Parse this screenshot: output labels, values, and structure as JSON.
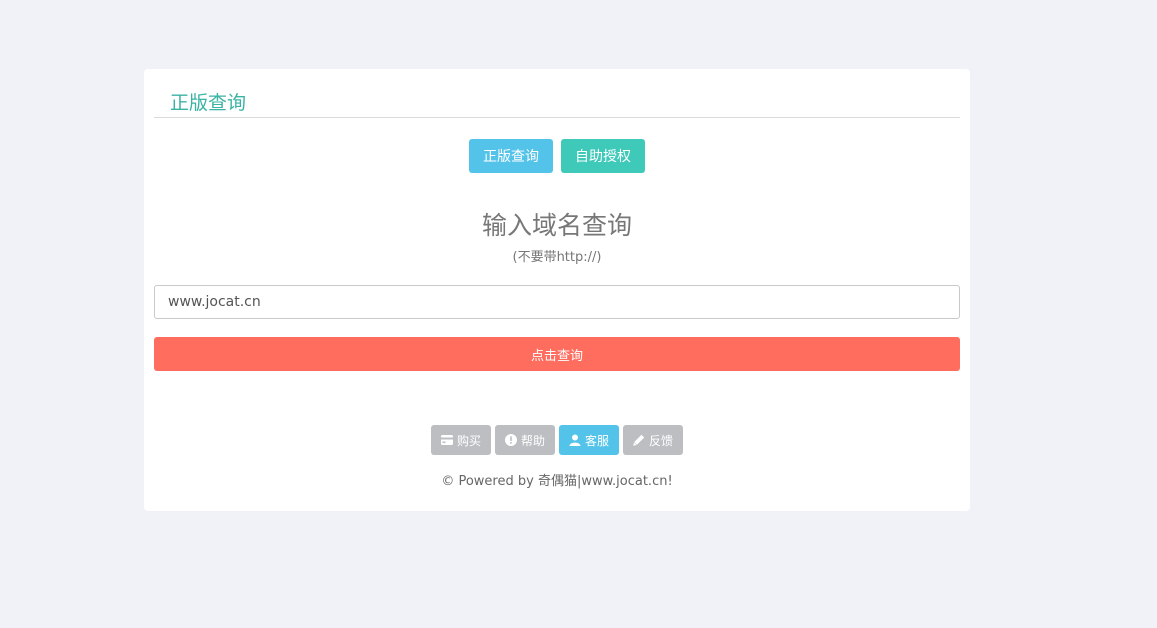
{
  "card": {
    "title": "正版查询"
  },
  "tabs": {
    "query_label": "正版查询",
    "auth_label": "自助授权"
  },
  "query": {
    "heading": "输入域名查询",
    "subheading": "(不要带http://)",
    "input_value": "www.jocat.cn",
    "submit_label": "点击查询"
  },
  "footer": {
    "buttons": [
      {
        "label": "购买",
        "icon": "credit-card-icon"
      },
      {
        "label": "帮助",
        "icon": "exclamation-circle-icon"
      },
      {
        "label": "客服",
        "icon": "user-icon"
      },
      {
        "label": "反馈",
        "icon": "pencil-icon"
      }
    ],
    "powered_text": "© Powered by 奇偶猫|www.jocat.cn!"
  },
  "colors": {
    "accent_teal": "#3ab3a4",
    "button_blue": "#54c3ea",
    "button_teal": "#3fc9b9",
    "submit_red": "#ff6d5f",
    "footer_gray": "#bcbec2"
  }
}
